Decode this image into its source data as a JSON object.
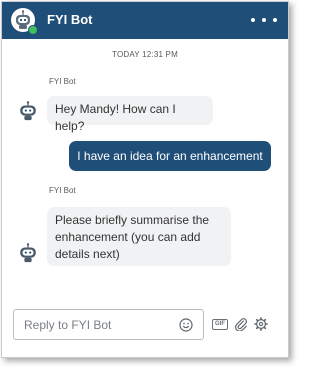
{
  "header": {
    "title": "FYI Bot",
    "avatar_icon": "robot-icon",
    "status_color": "#3fbf5f",
    "menu_icon": "more-horizontal-icon",
    "background": "#1f4e79"
  },
  "conversation": {
    "timestamp": "TODAY 12:31 PM",
    "messages": [
      {
        "sender": "FYI Bot",
        "from": "bot",
        "lines": [
          "Hey Mandy! How can I help?"
        ]
      },
      {
        "from": "user",
        "lines": [
          "I have an idea for an enhancement"
        ]
      },
      {
        "sender": "FYI Bot",
        "from": "bot",
        "lines": [
          "Please briefly summarise the",
          "enhancement (you can add",
          "details next)"
        ]
      }
    ]
  },
  "composer": {
    "placeholder": "Reply to FYI Bot",
    "emoji_icon": "emoji-icon",
    "gif_label": "GIF",
    "attach_icon": "paperclip-icon",
    "settings_icon": "gear-icon"
  }
}
